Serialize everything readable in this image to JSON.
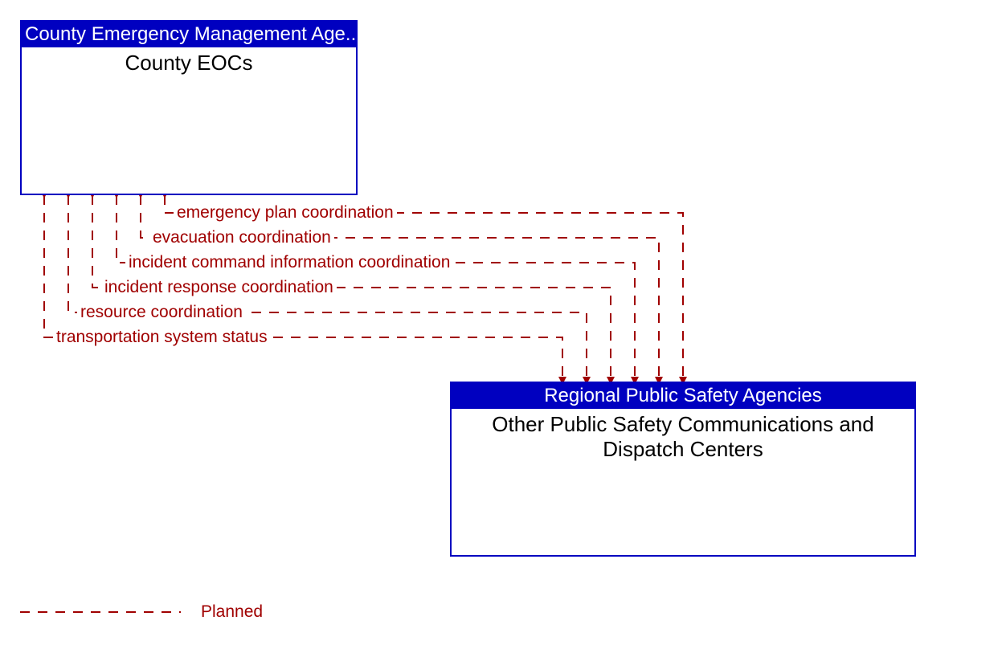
{
  "entities": {
    "top": {
      "header": "County Emergency Management Age...",
      "body": "County EOCs"
    },
    "bottom": {
      "header": "Regional Public Safety Agencies",
      "body": "Other Public Safety Communications and Dispatch Centers"
    }
  },
  "flows": {
    "f1": "emergency plan coordination",
    "f2": "evacuation coordination",
    "f3": "incident command information coordination",
    "f4": "incident response coordination",
    "f5": "resource coordination",
    "f6": "transportation system status"
  },
  "legend": {
    "planned": "Planned"
  },
  "colors": {
    "entity_border": "#0000c0",
    "flow_line": "#a00000"
  }
}
